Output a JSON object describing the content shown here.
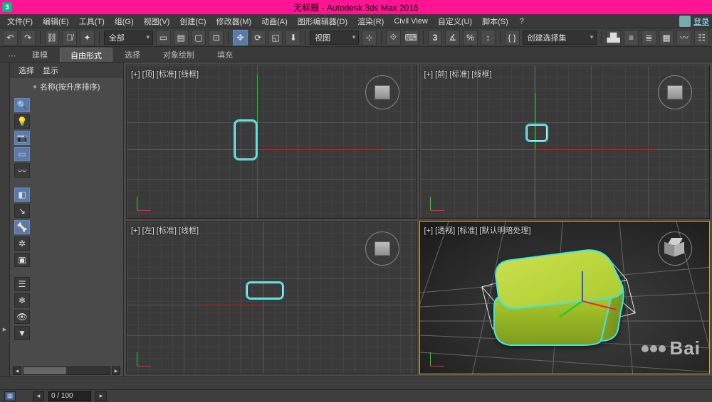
{
  "window": {
    "title": "无标题 - Autodesk 3ds Max 2018"
  },
  "menu": {
    "items": [
      "文件(F)",
      "编辑(E)",
      "工具(T)",
      "组(G)",
      "视图(V)",
      "创建(C)",
      "修改器(M)",
      "动画(A)",
      "图形编辑器(D)",
      "渲染(R)",
      "Civil View",
      "自定义(U)",
      "脚本(S)"
    ],
    "help_glyph": "?",
    "login": "登录"
  },
  "toolbar": {
    "selection_set_dd": "创建选择集",
    "all_dd": "全部",
    "view_dd": "视图"
  },
  "ribbon": {
    "tabs": [
      "建模",
      "自由形式",
      "选择",
      "对象绘制",
      "填充"
    ],
    "active_index": 1
  },
  "side_panel": {
    "tabs": [
      "选择",
      "显示"
    ],
    "name_sort_label": "名称(按升序排序)"
  },
  "viewports": {
    "top": {
      "label": "[+] [顶] [标准] [线框]"
    },
    "front": {
      "label": "[+] [前] [标准] [线框]"
    },
    "left": {
      "label": "[+] [左] [标准] [线框]"
    },
    "persp": {
      "label": "[+] [透视] [标准] [默认明暗处理]"
    }
  },
  "status": {
    "frame": "0 / 100"
  },
  "watermark": "Bai"
}
